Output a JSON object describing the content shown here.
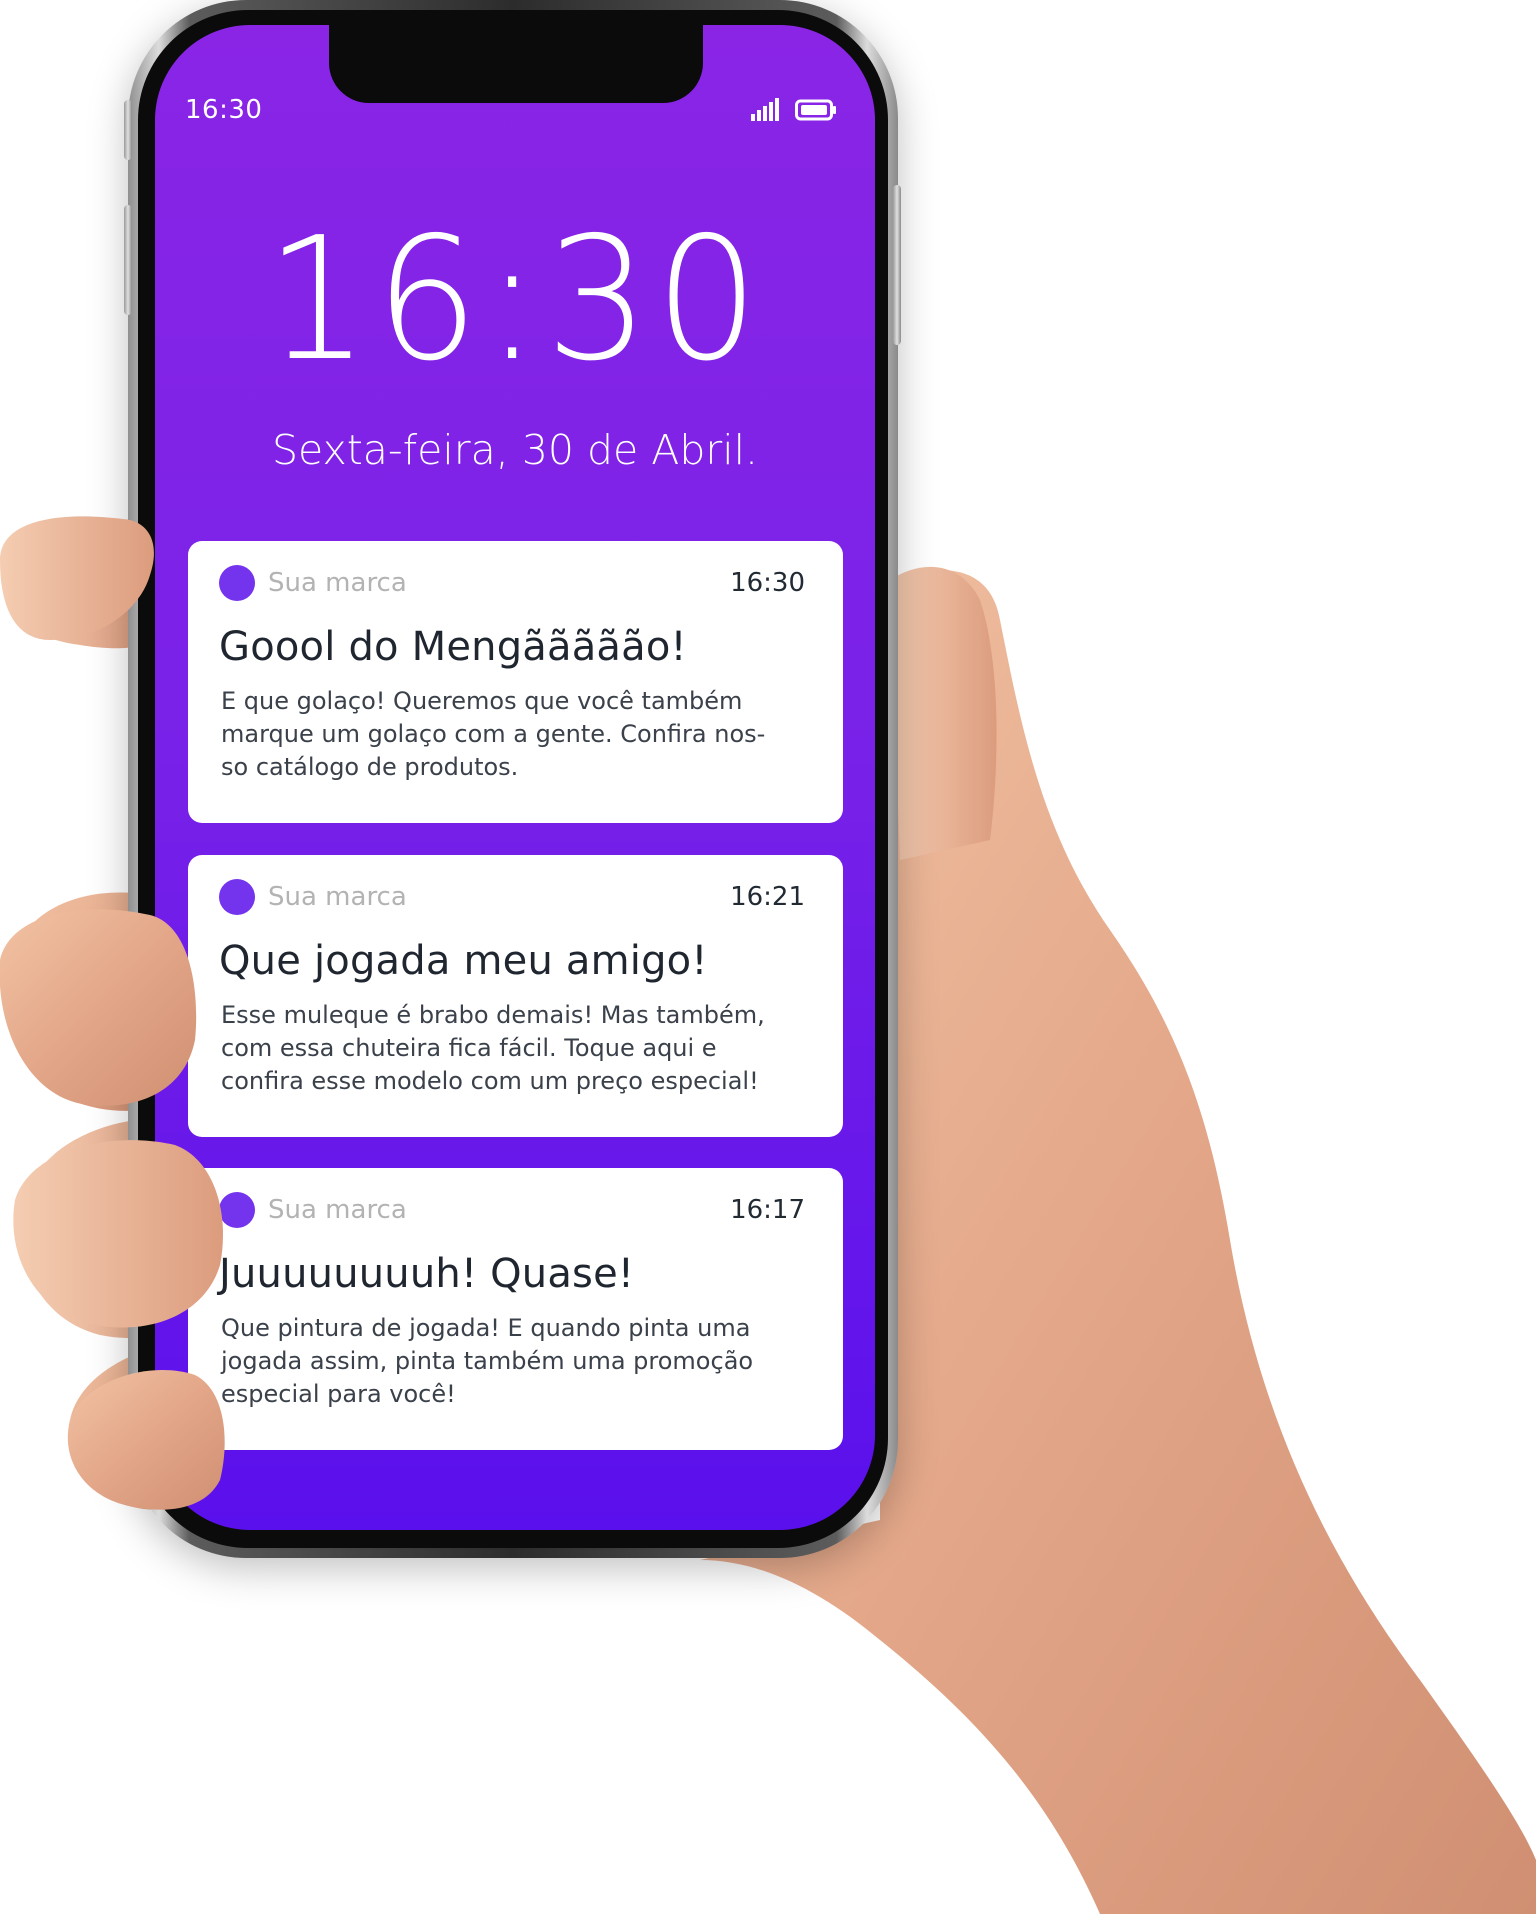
{
  "status_bar": {
    "time": "16:30",
    "signal_icon": "cellular-signal-icon",
    "battery_icon": "battery-icon"
  },
  "lock_screen": {
    "clock": "16:30",
    "date": "Sexta-feira, 30 de Abril."
  },
  "notifications": [
    {
      "brand": "Sua marca",
      "time": "16:30",
      "title": "Goool do Mengããããão!",
      "body": "E que golaço! Queremos que você também\nmarque um golaço com a gente. Confira nos-\nso catálogo de produtos."
    },
    {
      "brand": "Sua marca",
      "time": "16:21",
      "title": "Que jogada meu amigo!",
      "body": "Esse muleque é brabo demais! Mas também,\ncom essa chuteira fica fácil. Toque aqui e\nconfira esse modelo com um preço especial!"
    },
    {
      "brand": "Sua marca",
      "time": "16:17",
      "title": "Juuuuuuuuh! Quase!",
      "body": "Que pintura de jogada! E quando pinta uma\njogada assim, pinta também uma promoção\nespecial para você!"
    }
  ],
  "colors": {
    "screen_top": "#8a25e6",
    "screen_bottom": "#5a10ec",
    "brand_dot": "#7433ec",
    "card_background": "#ffffff",
    "title_text": "#1f2630"
  }
}
